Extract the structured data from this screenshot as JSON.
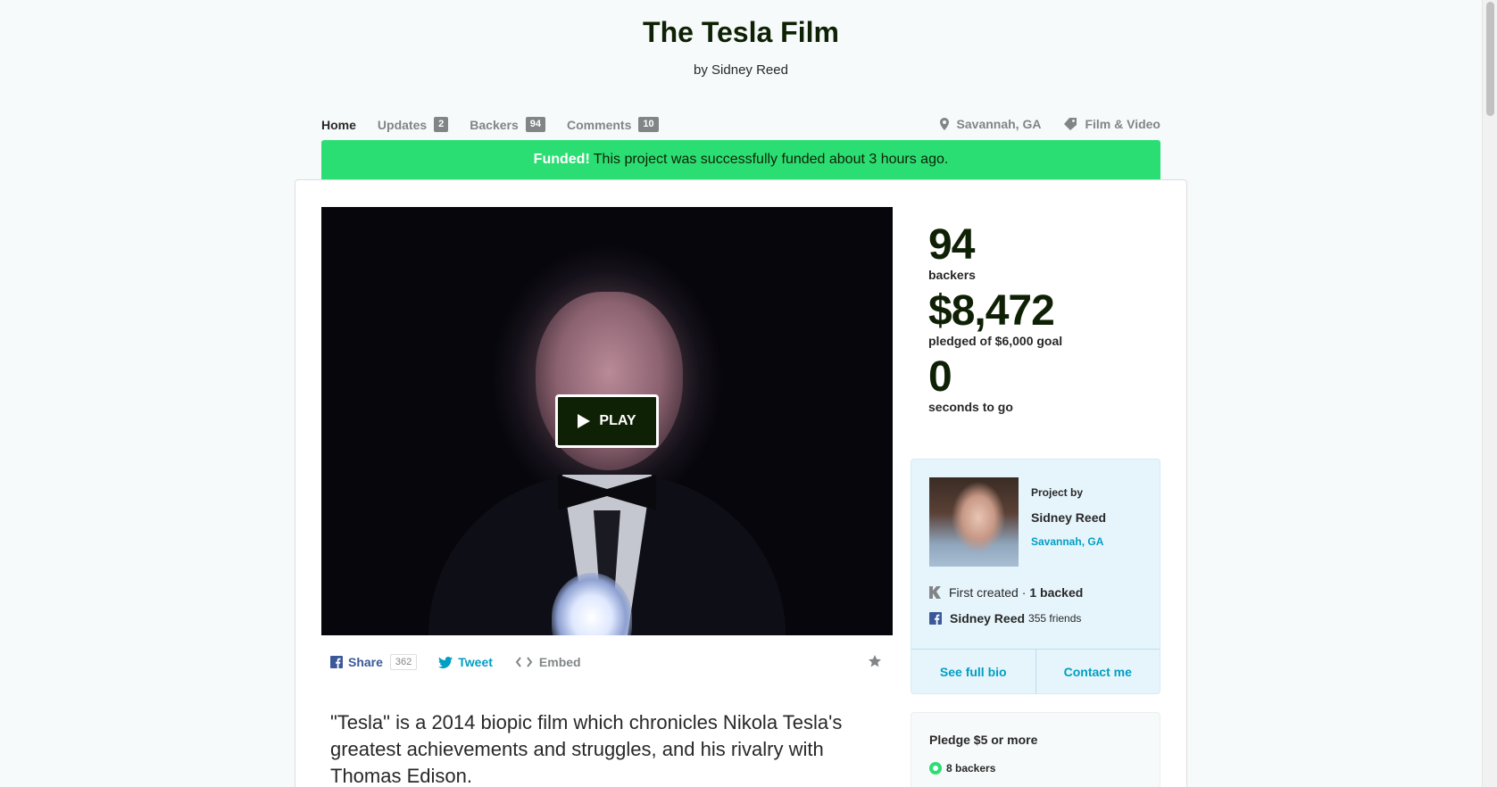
{
  "project": {
    "title": "The Tesla Film",
    "byline": "by Sidney Reed"
  },
  "tabs": [
    {
      "label": "Home",
      "count": null
    },
    {
      "label": "Updates",
      "count": "2"
    },
    {
      "label": "Backers",
      "count": "94"
    },
    {
      "label": "Comments",
      "count": "10"
    }
  ],
  "meta": {
    "location": "Savannah, GA",
    "category": "Film & Video",
    "location_icon": "map-pin-icon",
    "category_icon": "tag-icon"
  },
  "banner": {
    "strong": "Funded!",
    "text": "This project was successfully funded about 3 hours ago.",
    "color": "#2bde73"
  },
  "video": {
    "play_label": "PLAY"
  },
  "share": {
    "share_label": "Share",
    "share_count": "362",
    "tweet_label": "Tweet",
    "embed_label": "Embed"
  },
  "blurb": "\"Tesla\" is a 2014 biopic film which chronicles Nikola Tesla's greatest achievements and struggles, and his rivalry with Thomas Edison.",
  "stats": {
    "backers_num": "94",
    "backers_label": "backers",
    "pledged_num": "$8,472",
    "pledged_label": "pledged of $6,000 goal",
    "time_num": "0",
    "time_label": "seconds to go"
  },
  "creator": {
    "project_by": "Project by",
    "name": "Sidney Reed",
    "location": "Savannah, GA",
    "created_prefix": "First created ·",
    "created_backed": "1 backed",
    "fb_name": "Sidney Reed",
    "fb_friends": "355 friends",
    "see_bio": "See full bio",
    "contact": "Contact me"
  },
  "reward": {
    "title": "Pledge $5 or more",
    "backers": "8 backers"
  }
}
